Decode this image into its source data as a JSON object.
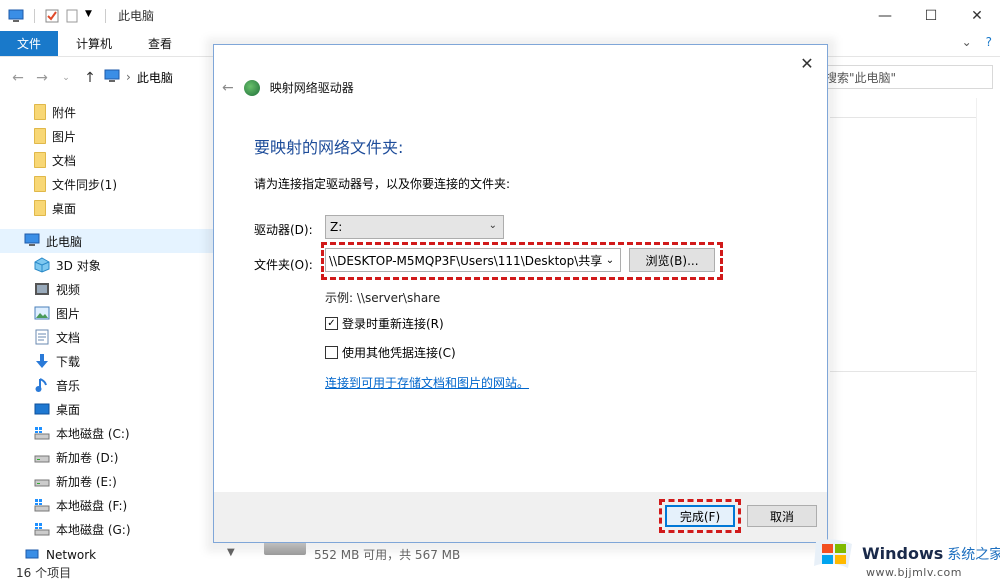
{
  "window": {
    "title": "此电脑"
  },
  "ribbon": {
    "tabs": [
      "文件",
      "计算机",
      "查看"
    ]
  },
  "address": {
    "location": "此电脑",
    "search_placeholder": "搜索\"此电脑\""
  },
  "sidebar": {
    "items": [
      {
        "label": "附件",
        "icon": "folder-icon"
      },
      {
        "label": "图片",
        "icon": "folder-icon"
      },
      {
        "label": "文档",
        "icon": "folder-icon"
      },
      {
        "label": "文件同步(1)",
        "icon": "folder-icon"
      },
      {
        "label": "桌面",
        "icon": "folder-icon"
      },
      {
        "label": "此电脑",
        "icon": "computer-icon",
        "selected": true
      },
      {
        "label": "3D 对象",
        "icon": "3d-objects-icon"
      },
      {
        "label": "视频",
        "icon": "video-icon"
      },
      {
        "label": "图片",
        "icon": "pictures-icon"
      },
      {
        "label": "文档",
        "icon": "documents-icon"
      },
      {
        "label": "下载",
        "icon": "download-icon"
      },
      {
        "label": "音乐",
        "icon": "music-icon"
      },
      {
        "label": "桌面",
        "icon": "desktop-icon"
      },
      {
        "label": "本地磁盘 (C:)",
        "icon": "windows-drive-icon"
      },
      {
        "label": "新加卷 (D:)",
        "icon": "drive-icon"
      },
      {
        "label": "新加卷 (E:)",
        "icon": "drive-icon"
      },
      {
        "label": "本地磁盘 (F:)",
        "icon": "windows-drive-icon"
      },
      {
        "label": "本地磁盘 (G:)",
        "icon": "windows-drive-icon"
      },
      {
        "label": "Network",
        "icon": "network-icon"
      }
    ]
  },
  "drive_info": "552 MB 可用，共 567 MB",
  "status": {
    "item_count": "16 个项目"
  },
  "dialog": {
    "title": "映射网络驱动器",
    "heading": "要映射的网络文件夹:",
    "instruction": "请为连接指定驱动器号，以及你要连接的文件夹:",
    "drive_label": "驱动器(D):",
    "drive_value": "Z:",
    "folder_label": "文件夹(O):",
    "folder_value": "\\\\DESKTOP-M5MQP3F\\Users\\111\\Desktop\\共享",
    "browse_label": "浏览(B)...",
    "example": "示例: \\\\server\\share",
    "reconnect_label": "登录时重新连接(R)",
    "reconnect_checked": true,
    "other_creds_label": "使用其他凭据连接(C)",
    "other_creds_checked": false,
    "link_text": "连接到可用于存储文档和图片的网站。",
    "finish_label": "完成(F)",
    "cancel_label": "取消"
  },
  "watermark": {
    "brand": "Windows",
    "brand_cn": "系统之家",
    "url": "www.bjjmlv.com"
  },
  "colors": {
    "accent": "#1979ca",
    "highlight": "#d11a1a",
    "heading": "#1d4c9a",
    "link": "#0066cc"
  }
}
